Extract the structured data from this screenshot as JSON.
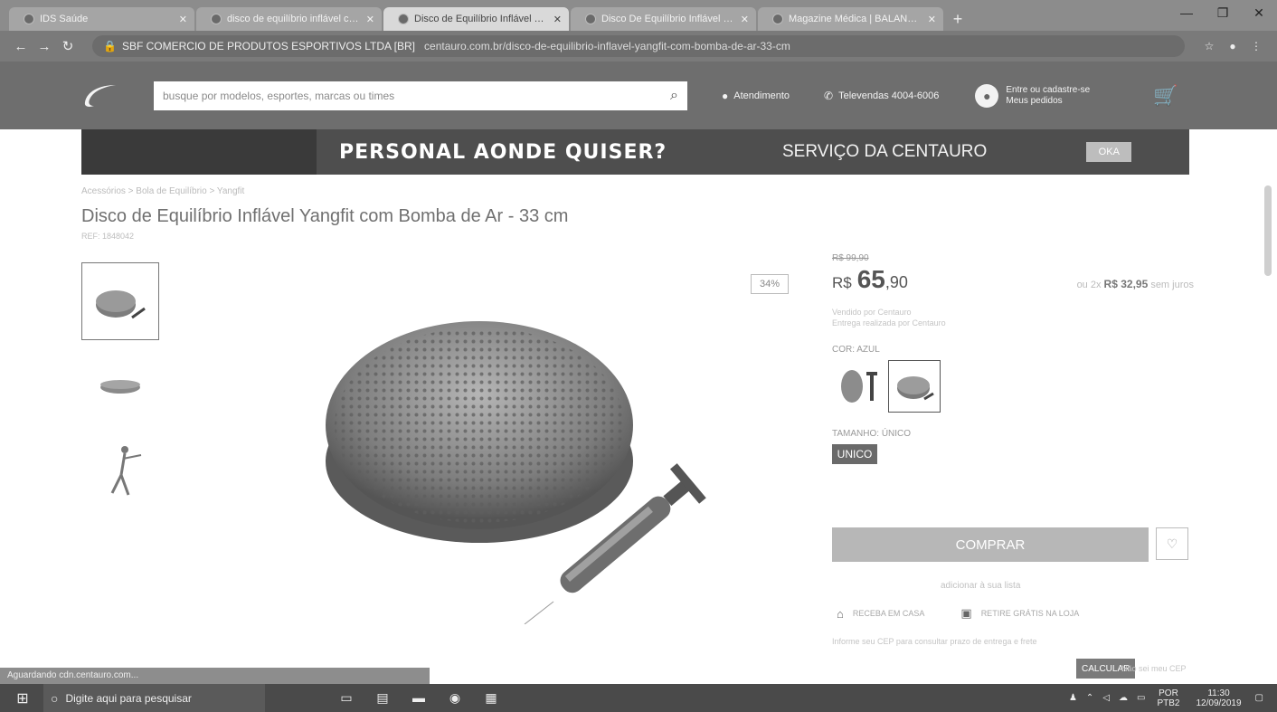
{
  "browser": {
    "tabs": [
      {
        "label": "IDS Saúde",
        "active": false
      },
      {
        "label": "disco de equilíbrio inflável comp",
        "active": false
      },
      {
        "label": "Disco de Equilíbrio Inflável Yangf",
        "active": true
      },
      {
        "label": "Disco De Equilíbrio Inflável Cam",
        "active": false
      },
      {
        "label": "Magazine Médica | BALANCINHO",
        "active": false
      }
    ],
    "cert": "SBF COMERCIO DE PRODUTOS ESPORTIVOS LTDA [BR]",
    "url": "centauro.com.br/disco-de-equilibrio-inflavel-yangfit-com-bomba-de-ar-33-cm"
  },
  "header": {
    "search_placeholder": "busque por modelos, esportes, marcas ou times",
    "atendimento": "Atendimento",
    "televendas": "Televendas 4004-6006",
    "account_line1": "Entre ou cadastre-se",
    "account_line2": "Meus pedidos"
  },
  "banner": {
    "left": "PERSONAL AONDE QUISER?",
    "right": "SERVIÇO DA CENTAURO",
    "badge": "OKA"
  },
  "product": {
    "breadcrumb": "Acessórios > Bola de Equilíbrio > Yangfit",
    "title": "Disco de Equilíbrio Inflável Yangfit com Bomba de Ar - 33 cm",
    "ref": "REF: 1848042",
    "discount": "34%",
    "old_price": "R$ 99,90",
    "currency": "R$",
    "price_int": "65",
    "price_cents": ",90",
    "installments_prefix": "ou 2x",
    "installments_value": "R$ 32,95",
    "installments_suffix": "sem juros",
    "seller_line1": "Vendido por Centauro",
    "seller_line2": "Entrega realizada por Centauro",
    "color_label": "COR: AZUL",
    "size_label": "TAMANHO: ÚNICO",
    "size_value": "UNICO",
    "buy_label": "COMPRAR",
    "add_list": "adicionar à sua lista",
    "receive_home": "RECEBA EM CASA",
    "pickup": "RETIRE GRÁTIS NA LOJA",
    "zip_note": "Informe seu CEP para consultar prazo de entrega e frete",
    "calc_label": "CALCULAR",
    "cep_note": "Não sei meu CEP"
  },
  "status": {
    "text": "Aguardando cdn.centauro.com..."
  },
  "taskbar": {
    "search_placeholder": "Digite aqui para pesquisar",
    "lang_top": "POR",
    "lang_bottom": "PTB2",
    "time": "11:30",
    "date": "12/09/2019"
  }
}
